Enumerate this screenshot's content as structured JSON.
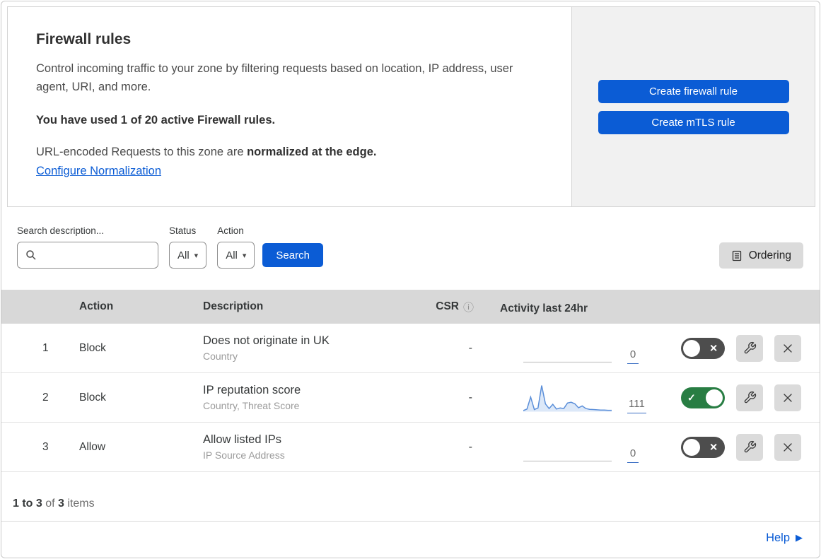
{
  "header": {
    "title": "Firewall rules",
    "description": "Control incoming traffic to your zone by filtering requests based on location, IP address, user agent, URI, and more.",
    "usage_bold": "You have used 1 of 20 active Firewall rules.",
    "normalization_text": "URL-encoded Requests to this zone are ",
    "normalization_bold": "normalized at the edge.",
    "normalization_link": "Configure Normalization"
  },
  "actions_panel": {
    "create_firewall_label": "Create firewall rule",
    "create_mtls_label": "Create mTLS rule"
  },
  "filters": {
    "search_label": "Search description...",
    "search_value": "",
    "status_label": "Status",
    "status_value": "All",
    "action_label": "Action",
    "action_value": "All",
    "search_button_label": "Search",
    "ordering_button_label": "Ordering"
  },
  "table": {
    "columns": {
      "action": "Action",
      "description": "Description",
      "csr": "CSR",
      "activity": "Activity last 24hr"
    },
    "rows": [
      {
        "priority": "1",
        "action": "Block",
        "description": "Does not originate in UK",
        "fields": "Country",
        "csr": "-",
        "activity_count": "0",
        "enabled": false,
        "sparkline": null
      },
      {
        "priority": "2",
        "action": "Block",
        "description": "IP reputation score",
        "fields": "Country, Threat Score",
        "csr": "-",
        "activity_count": "111",
        "enabled": true,
        "sparkline": [
          4,
          10,
          56,
          8,
          14,
          100,
          30,
          12,
          28,
          10,
          14,
          12,
          33,
          36,
          30,
          15,
          22,
          12,
          9,
          8,
          7,
          6,
          6,
          5,
          5
        ]
      },
      {
        "priority": "3",
        "action": "Allow",
        "description": "Allow listed IPs",
        "fields": "IP Source Address",
        "csr": "-",
        "activity_count": "0",
        "enabled": false,
        "sparkline": null
      }
    ]
  },
  "footer": {
    "range_bold": "1 to 3",
    "of_text": " of ",
    "total_bold": "3",
    "items_text": " items",
    "help_label": "Help"
  },
  "icons": {
    "info": "ⓘ",
    "select_caret": "▾",
    "toggle_on_mark": "✓",
    "toggle_off_mark": "✕",
    "help_arrow": "▶"
  },
  "colors": {
    "primary_blue": "#0b5cd5",
    "link_blue": "#0b5cd5",
    "panel_bg": "#f1f1f1",
    "table_header_bg": "#d8d8d8",
    "icon_button_bg": "#dbdbdb",
    "toggle_on": "#287d43",
    "toggle_off": "#4d4d4d",
    "sparkline_stroke": "#5b8fd9",
    "sparkline_fill": "#dce8f8",
    "flat_line": "#c9c9c9"
  },
  "chart_data": {
    "type": "area",
    "title": "Activity last 24hr sparkline (rule 2: IP reputation score)",
    "values": [
      4,
      10,
      56,
      8,
      14,
      100,
      30,
      12,
      28,
      10,
      14,
      12,
      33,
      36,
      30,
      15,
      22,
      12,
      9,
      8,
      7,
      6,
      6,
      5,
      5
    ],
    "ylim": [
      0,
      100
    ],
    "total_events": 111
  }
}
